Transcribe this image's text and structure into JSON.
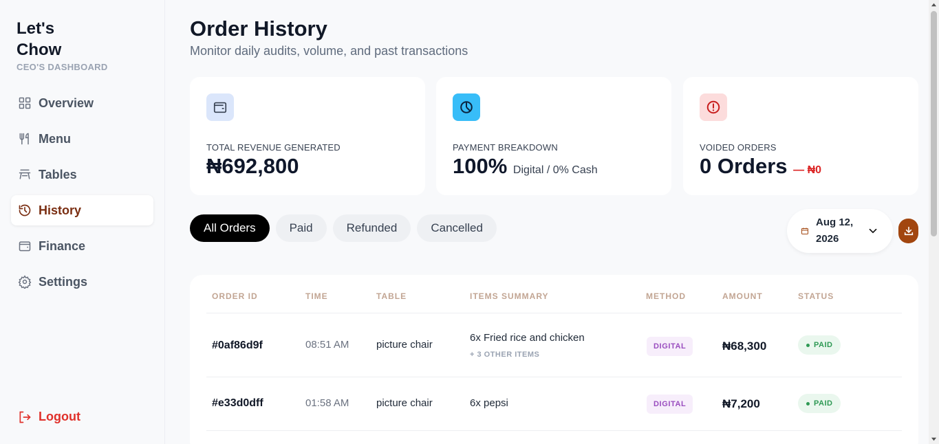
{
  "sidebar": {
    "brand_name": "Let's Chow",
    "brand_sub": "CEO'S DASHBOARD",
    "items": [
      {
        "label": "Overview",
        "icon": "grid-icon"
      },
      {
        "label": "Menu",
        "icon": "fork-knife-icon"
      },
      {
        "label": "Tables",
        "icon": "table-icon"
      },
      {
        "label": "History",
        "icon": "history-icon",
        "active": true
      },
      {
        "label": "Finance",
        "icon": "wallet-icon"
      },
      {
        "label": "Settings",
        "icon": "gear-icon"
      }
    ],
    "logout_label": "Logout"
  },
  "header": {
    "title": "Order History",
    "subtitle": "Monitor daily audits, volume, and past transactions"
  },
  "cards": {
    "revenue": {
      "label": "TOTAL REVENUE GENERATED",
      "value": "₦692,800",
      "icon": "wallet-icon",
      "icon_bg": "#dbe6fb"
    },
    "payment": {
      "label": "PAYMENT BREAKDOWN",
      "value": "100%",
      "detail": "Digital / 0% Cash",
      "icon": "pie-chart-icon",
      "icon_bg": "#38bdf8"
    },
    "voided": {
      "label": "VOIDED ORDERS",
      "value": "0 Orders",
      "amount": "— ₦0",
      "icon": "alert-circle-icon",
      "icon_bg": "#fcdcdc"
    }
  },
  "filters": {
    "tabs": [
      "All Orders",
      "Paid",
      "Refunded",
      "Cancelled"
    ],
    "active": "All Orders"
  },
  "date_picker": {
    "value": "Aug 12, 2026"
  },
  "table": {
    "columns": [
      "ORDER ID",
      "TIME",
      "TABLE",
      "ITEMS SUMMARY",
      "METHOD",
      "AMOUNT",
      "STATUS"
    ],
    "rows": [
      {
        "order_id": "#0af86d9f",
        "time": "08:51 AM",
        "table": "picture chair",
        "items": "6x Fried rice and chicken",
        "more": "+ 3 OTHER ITEMS",
        "method": "DIGITAL",
        "amount": "₦68,300",
        "status": "PAID"
      },
      {
        "order_id": "#e33d0dff",
        "time": "01:58 AM",
        "table": "picture chair",
        "items": "6x pepsi",
        "more": "",
        "method": "DIGITAL",
        "amount": "₦7,200",
        "status": "PAID"
      }
    ]
  },
  "colors": {
    "accent": "#a2460f",
    "active_nav": "#7a2e12",
    "logout": "#e0312b",
    "paid": "#2e9954",
    "digital": "#9a4dbf",
    "voided": "#dc2626"
  }
}
